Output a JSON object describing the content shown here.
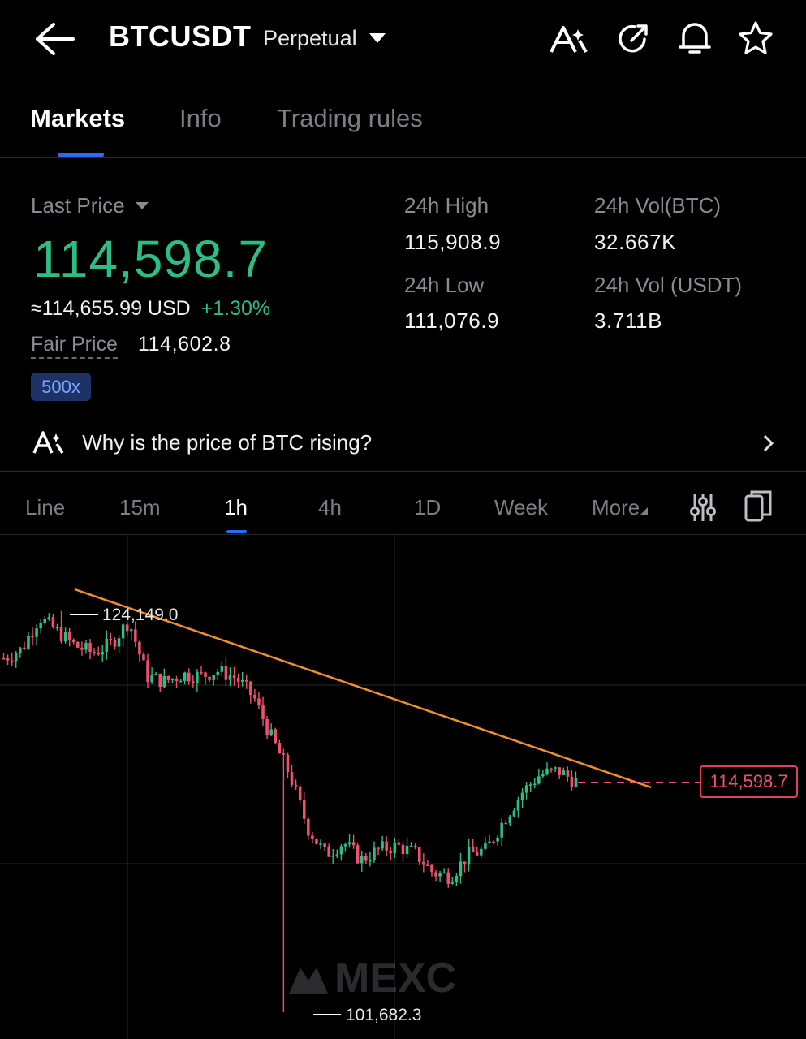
{
  "header": {
    "symbol": "BTCUSDT",
    "contract_type": "Perpetual",
    "icons": [
      "back-arrow-icon",
      "ai-icon",
      "share-icon",
      "bell-icon",
      "star-icon"
    ]
  },
  "tabs": [
    {
      "label": "Markets",
      "active": true
    },
    {
      "label": "Info",
      "active": false
    },
    {
      "label": "Trading rules",
      "active": false
    }
  ],
  "price": {
    "last_label": "Last Price",
    "last": "114,598.7",
    "usd_equiv": "≈114,655.99 USD",
    "change": "+1.30%",
    "fair_label": "Fair Price",
    "fair": "114,602.8",
    "leverage": "500x"
  },
  "stats": {
    "high_label": "24h High",
    "high": "115,908.9",
    "low_label": "24h Low",
    "low": "111,076.9",
    "vol_btc_label": "24h Vol(BTC)",
    "vol_btc": "32.667K",
    "vol_usdt_label": "24h Vol (USDT)",
    "vol_usdt": "3.711B"
  },
  "ai_prompt": "Why is the price of BTC rising?",
  "timeframes": [
    {
      "label": "Line",
      "active": false
    },
    {
      "label": "15m",
      "active": false
    },
    {
      "label": "1h",
      "active": true
    },
    {
      "label": "4h",
      "active": false
    },
    {
      "label": "1D",
      "active": false
    },
    {
      "label": "Week",
      "active": false
    },
    {
      "label": "More",
      "active": false
    }
  ],
  "colors": {
    "up": "#2ebd85",
    "down": "#f0506e",
    "accent": "#2a6bf5",
    "trendline": "#f0902a"
  },
  "chart_data": {
    "type": "candlestick",
    "y_ticks": [
      "120,000.0",
      "110,000.0",
      "100,000.0"
    ],
    "high_marker": "124,149.0",
    "low_marker": "101,682.3",
    "current_price_tag": "114,598.7",
    "watermark": "MEXC",
    "trendline": true,
    "close_path": [
      121500,
      122000,
      123800,
      123000,
      122200,
      121800,
      122300,
      123600,
      120500,
      120200,
      120600,
      120500,
      120800,
      120400,
      119300,
      117000,
      115000,
      112000,
      110500,
      111200,
      110200,
      110800,
      111000,
      110600,
      109500,
      109300,
      110500,
      110800,
      112500,
      114000,
      115000,
      115200,
      114600
    ]
  }
}
